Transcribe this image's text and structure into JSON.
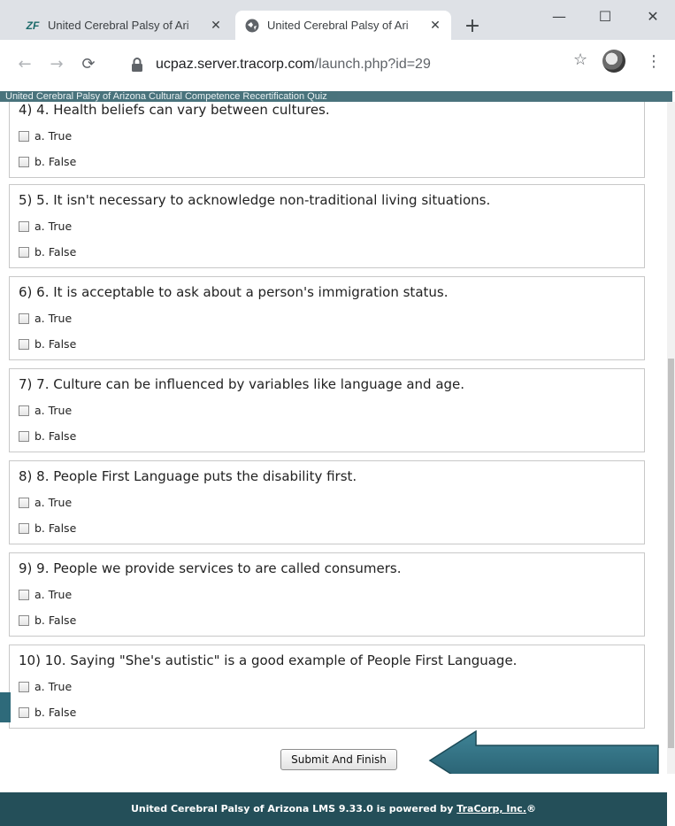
{
  "browser": {
    "tabs": [
      {
        "title": "United Cerebral Palsy of Ari",
        "favicon": "zf-logo",
        "active": false
      },
      {
        "title": "United Cerebral Palsy of Ari",
        "favicon": "globe-icon",
        "active": true
      }
    ],
    "url": {
      "host": "ucpaz.server.tracorp.com",
      "path": "/launch.php?id=29"
    },
    "controls": {
      "minimize": "—",
      "maximize": "☐",
      "close": "✕",
      "new_tab": "+"
    }
  },
  "page": {
    "header_text": "United Cerebral Palsy of Arizona Cultural Competence Recertification Quiz",
    "questions": [
      {
        "text": "4) 4. Health beliefs can vary between cultures.",
        "options": [
          "a. True",
          "b. False"
        ]
      },
      {
        "text": "5) 5. It isn't necessary to acknowledge non-traditional living situations.",
        "options": [
          "a. True",
          "b. False"
        ]
      },
      {
        "text": "6) 6. It is acceptable to ask about a person's immigration status.",
        "options": [
          "a. True",
          "b. False"
        ]
      },
      {
        "text": "7) 7. Culture can be influenced by variables like language and age.",
        "options": [
          "a. True",
          "b. False"
        ]
      },
      {
        "text": "8) 8. People First Language puts the disability first.",
        "options": [
          "a. True",
          "b. False"
        ]
      },
      {
        "text": "9) 9. People we provide services to are called consumers.",
        "options": [
          "a. True",
          "b. False"
        ]
      },
      {
        "text": "10) 10. Saying \"She's autistic\" is a good example of People First Language.",
        "options": [
          "a. True",
          "b. False"
        ]
      }
    ],
    "submit_label": "Submit And Finish",
    "footer": {
      "prefix": "United Cerebral Palsy of Arizona LMS 9.33.0 is powered by ",
      "link": "TraCorp, Inc.",
      "suffix": "®"
    }
  },
  "colors": {
    "footer_bg": "#244f59",
    "arrow": "#2e6a7a"
  }
}
